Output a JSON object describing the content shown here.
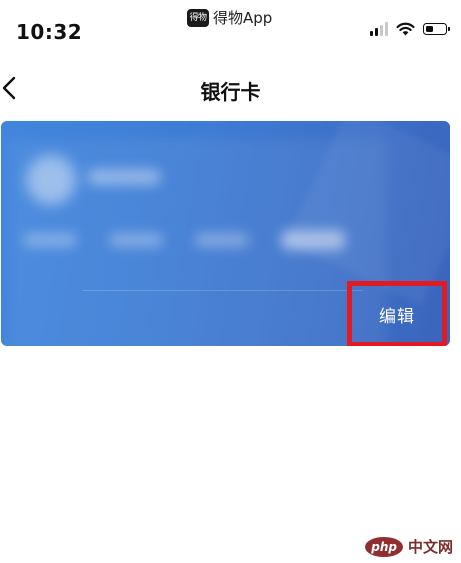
{
  "status_bar": {
    "time": "10:32",
    "app_name": "得物App",
    "app_logo_text": "得物",
    "signal_icon": "signal-bars-icon",
    "wifi_icon": "wifi-icon",
    "battery_icon": "battery-icon"
  },
  "nav": {
    "back_icon": "chevron-left-icon",
    "title": "银行卡"
  },
  "card": {
    "edit_label": "编辑",
    "highlight_color": "#e11a24",
    "card_colors": [
      "#4186dd",
      "#3a64bc"
    ]
  },
  "footer": {
    "watermark_logo": "php",
    "watermark_text": "中文网"
  }
}
